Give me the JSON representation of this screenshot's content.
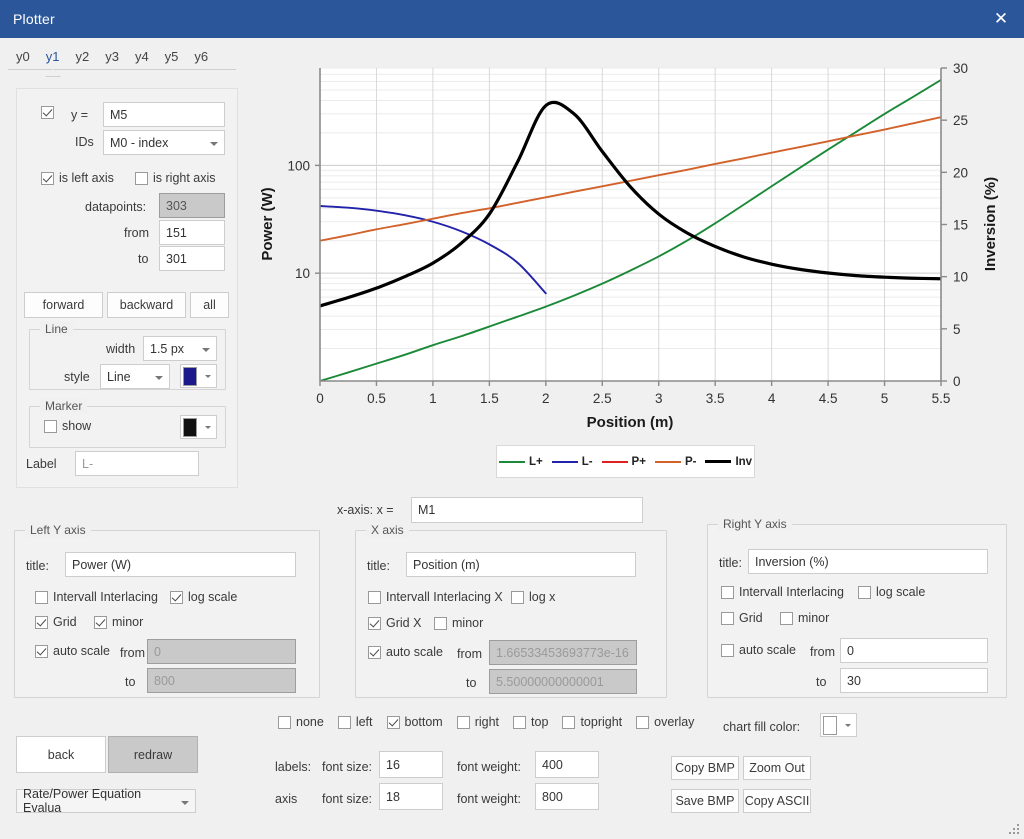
{
  "window": {
    "title": "Plotter",
    "close_icon": "close-icon"
  },
  "tabs": [
    {
      "label": "y0",
      "active": false
    },
    {
      "label": "y1",
      "active": true
    },
    {
      "label": "y2",
      "active": false
    },
    {
      "label": "y3",
      "active": false
    },
    {
      "label": "y4",
      "active": false
    },
    {
      "label": "y5",
      "active": false
    },
    {
      "label": "y6",
      "active": false
    }
  ],
  "series_panel": {
    "enabled_checkbox": true,
    "y_label": "y =",
    "y_value": "M5",
    "ids_label": "IDs",
    "ids_value": "M0 - index",
    "is_left_axis_label": "is left axis",
    "is_left_axis_checked": true,
    "is_right_axis_label": "is right axis",
    "is_right_axis_checked": false,
    "datapoints_label": "datapoints:",
    "datapoints_value": "303",
    "from_label": "from",
    "from_value": "151",
    "to_label": "to",
    "to_value": "301",
    "forward_label": "forward",
    "backward_label": "backward",
    "all_label": "all",
    "line_group_title": "Line",
    "line_width_label": "width",
    "line_width_value": "1.5 px",
    "line_style_label": "style",
    "line_style_value": "Line",
    "line_color": "#1a1a8c",
    "marker_group_title": "Marker",
    "marker_show_label": "show",
    "marker_show_checked": false,
    "marker_color": "#111111",
    "label_label": "Label",
    "label_value": "L-"
  },
  "xaxis_expr": {
    "label": "x-axis: x =",
    "value": "M1"
  },
  "left_y_axis": {
    "group_title": "Left Y axis",
    "title_label": "title:",
    "title_value": "Power (W)",
    "interlacing_label": "Intervall Interlacing",
    "interlacing_checked": false,
    "log_label": "log scale",
    "log_checked": true,
    "grid_label": "Grid",
    "grid_checked": true,
    "minor_label": "minor",
    "minor_checked": true,
    "autoscale_label": "auto scale",
    "autoscale_checked": true,
    "from_label": "from",
    "from_value": "0",
    "to_label": "to",
    "to_value": "800"
  },
  "x_axis": {
    "group_title": "X axis",
    "title_label": "title:",
    "title_value": "Position (m)",
    "interlacing_label": "Intervall Interlacing X",
    "interlacing_checked": false,
    "log_label": "log x",
    "log_checked": false,
    "grid_label": "Grid X",
    "grid_checked": true,
    "minor_label": "minor",
    "minor_checked": false,
    "autoscale_label": "auto scale",
    "autoscale_checked": true,
    "from_label": "from",
    "from_value": "1.66533453693773e-16",
    "to_label": "to",
    "to_value": "5.50000000000001"
  },
  "right_y_axis": {
    "group_title": "Right Y axis",
    "title_label": "title:",
    "title_value": "Inversion (%)",
    "interlacing_label": "Intervall Interlacing",
    "interlacing_checked": false,
    "log_label": "log scale",
    "log_checked": false,
    "grid_label": "Grid",
    "grid_checked": false,
    "minor_label": "minor",
    "minor_checked": false,
    "autoscale_label": "auto scale",
    "autoscale_checked": false,
    "from_label": "from",
    "from_value": "0",
    "to_label": "to",
    "to_value": "30"
  },
  "legend_position": [
    {
      "label": "none",
      "checked": false
    },
    {
      "label": "left",
      "checked": false
    },
    {
      "label": "bottom",
      "checked": true
    },
    {
      "label": "right",
      "checked": false
    },
    {
      "label": "top",
      "checked": false
    },
    {
      "label": "topright",
      "checked": false
    },
    {
      "label": "overlay",
      "checked": false
    }
  ],
  "fonts": {
    "labels_label": "labels:",
    "labels_fontsize_label": "font size:",
    "labels_fontsize_value": "16",
    "labels_fontweight_label": "font weight:",
    "labels_fontweight_value": "400",
    "axis_label": "axis",
    "axis_fontsize_label": "font size:",
    "axis_fontsize_value": "18",
    "axis_fontweight_label": "font weight:",
    "axis_fontweight_value": "800"
  },
  "chart_fill": {
    "label": "chart fill color:",
    "color": "#ffffff"
  },
  "actions": {
    "back_label": "back",
    "redraw_label": "redraw",
    "equation_select_value": "Rate/Power Equation Evalua",
    "copy_bmp_label": "Copy BMP",
    "zoom_out_label": "Zoom Out",
    "save_bmp_label": "Save BMP",
    "copy_ascii_label": "Copy ASCII"
  },
  "chart_data": {
    "type": "line",
    "title": "",
    "xlabel": "Position (m)",
    "ylabel": "Power (W)",
    "y2label": "Inversion (%)",
    "xlim": [
      0,
      5.5
    ],
    "xticks": [
      0,
      0.5,
      1,
      1.5,
      2,
      2.5,
      3,
      3.5,
      4,
      4.5,
      5,
      5.5
    ],
    "xticklabels": [
      "0",
      "0.5",
      "1",
      "1.5",
      "2",
      "2.5",
      "3",
      "3.5",
      "4",
      "4.5",
      "5",
      "5.5"
    ],
    "ylim": [
      1.0,
      800
    ],
    "yscale": "log",
    "yticks": [
      10,
      100
    ],
    "yticklabels": [
      "10",
      "100"
    ],
    "y2lim": [
      0,
      30
    ],
    "y2ticks": [
      0,
      5,
      10,
      15,
      20,
      25,
      30
    ],
    "y2ticklabels": [
      "0",
      "5",
      "10",
      "15",
      "20",
      "25",
      "30"
    ],
    "grid": true,
    "grid_minor_y": true,
    "legend_position": "bottom",
    "x": [
      0,
      0.25,
      0.5,
      0.75,
      1,
      1.25,
      1.5,
      1.75,
      2,
      2.25,
      2.5,
      2.75,
      3,
      3.25,
      3.5,
      3.75,
      4,
      4.25,
      4.5,
      4.75,
      5,
      5.25,
      5.5
    ],
    "series": [
      {
        "name": "L+",
        "axis": "left",
        "color": "#1a8a38",
        "values": [
          1.0,
          1.2,
          1.45,
          1.75,
          2.15,
          2.6,
          3.2,
          3.95,
          4.9,
          6.2,
          8.0,
          10.6,
          14.3,
          20.0,
          29.0,
          43.0,
          64.0,
          95.0,
          140.0,
          205.0,
          300.0,
          430.0,
          620.0
        ]
      },
      {
        "name": "L-",
        "axis": "left",
        "color": "#2222aa",
        "values": [
          42.0,
          40.5,
          38.0,
          34.5,
          30.0,
          24.5,
          18.5,
          12.5,
          6.5,
          null,
          null,
          null,
          null,
          null,
          null,
          null,
          null,
          null,
          null,
          null,
          null,
          null,
          null
        ]
      },
      {
        "name": "P+",
        "axis": "left",
        "color": "#e02020",
        "values": [
          null,
          null,
          null,
          null,
          null,
          null,
          null,
          null,
          null,
          null,
          null,
          null,
          null,
          null,
          null,
          null,
          null,
          null,
          null,
          null,
          null,
          null,
          null
        ]
      },
      {
        "name": "P-",
        "axis": "left",
        "color": "#d2622a",
        "values": [
          20.0,
          22.5,
          25.5,
          28.5,
          32.0,
          36.0,
          40.0,
          45.0,
          50.5,
          57.0,
          64.0,
          72.0,
          81.0,
          91.0,
          103.0,
          116.0,
          131.0,
          148.0,
          167.0,
          190.0,
          215.0,
          245.0,
          280.0
        ]
      },
      {
        "name": "Inv",
        "axis": "right",
        "color": "#000000",
        "values": [
          7.2,
          8.0,
          8.9,
          10.0,
          11.3,
          13.2,
          16.0,
          21.0,
          26.4,
          25.6,
          22.0,
          18.6,
          16.0,
          14.2,
          12.9,
          11.9,
          11.2,
          10.7,
          10.35,
          10.1,
          9.95,
          9.85,
          9.8
        ]
      }
    ]
  }
}
